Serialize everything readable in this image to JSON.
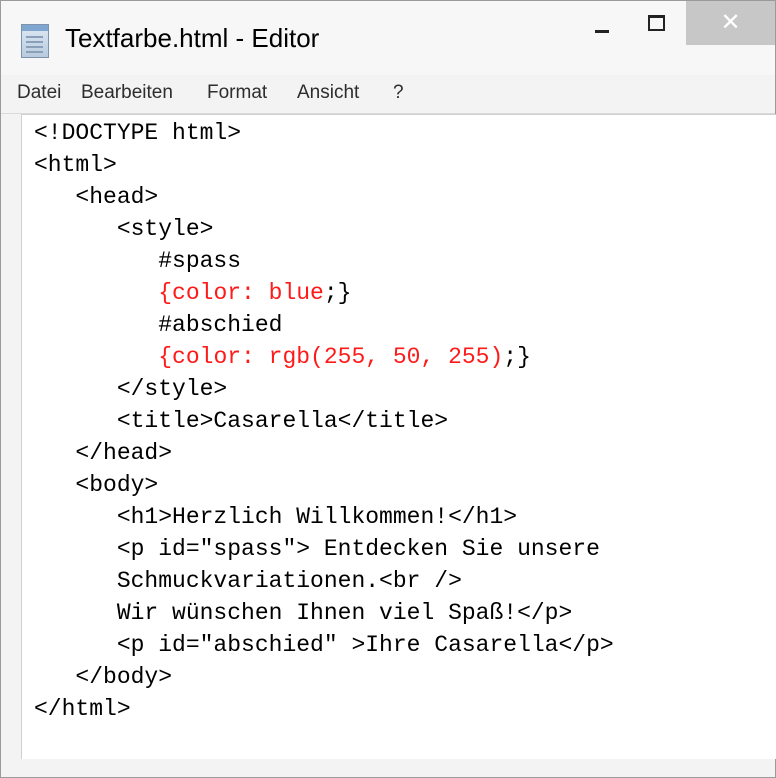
{
  "window": {
    "title": "Textfarbe.html - Editor",
    "icon": "notepad-icon",
    "controls": {
      "minimize": "minimize-icon",
      "maximize": "maximize-icon",
      "close_glyph": "✕"
    }
  },
  "menu": {
    "items": [
      "Datei",
      "Bearbeiten",
      "Format",
      "Ansicht",
      "?"
    ]
  },
  "editor": {
    "highlight_color": "#ff1a1a",
    "lines": [
      "<!DOCTYPE html>",
      "<html>",
      "   <head>",
      "      <style>",
      "         #spass",
      "         {color: blue;}",
      "         #abschied",
      "         {color: rgb(255, 50, 255);}",
      "      </style>",
      "      <title>Casarella</title>",
      "   </head>",
      "   <body>",
      "      <h1>Herzlich Willkommen!</h1>",
      "      <p id=\"spass\"> Entdecken Sie unsere",
      "      Schmuckvariationen.<br />",
      "      Wir wünschen Ihnen viel Spaß!</p>",
      "      <p id=\"abschied\" >Ihre Casarella</p>",
      "   </body>",
      "</html>"
    ],
    "highlighted_line_indices": [
      5,
      7
    ]
  }
}
